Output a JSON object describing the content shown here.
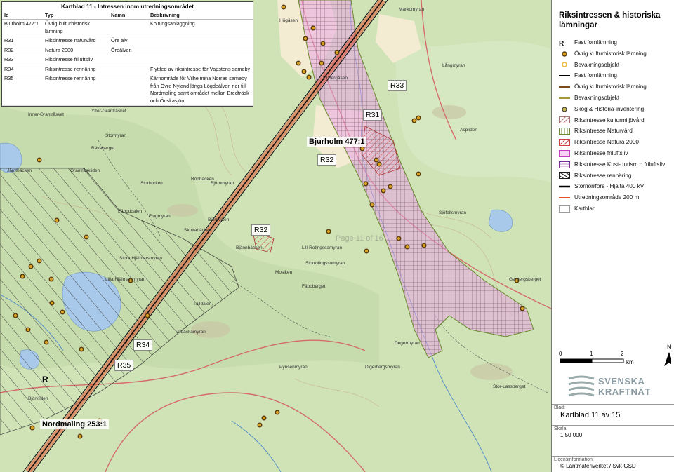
{
  "table": {
    "title": "Kartblad 11 - Intressen inom utredningsområdet",
    "headers": [
      "Id",
      "Typ",
      "Namn",
      "Beskrivning"
    ],
    "rows": [
      [
        "Bjurholm 477:1",
        "Övrig kulturhistorisk lämning",
        "",
        "Kolningsanläggning"
      ],
      [
        "R31",
        "Riksintresse naturvård",
        "Öre älv",
        ""
      ],
      [
        "R32",
        "Natura 2000",
        "Öreälven",
        ""
      ],
      [
        "R33",
        "Riksintresse friluftsliv",
        "",
        ""
      ],
      [
        "R34",
        "Riksintresse rennäring",
        "",
        "Flyttled av riksintresse för Vapstens sameby"
      ],
      [
        "R35",
        "Riksintresse rennäring",
        "",
        "Kärnområde för Vilhelmina Norras sameby från Övre Nyland längs Lögdeälven ner till Nordmaling samt området mellan Bredträsk och Önskasjön"
      ]
    ]
  },
  "map_labels": {
    "r33": "R33",
    "r31": "R31",
    "bjurholm": "Bjurholm 477:1",
    "r32a": "R32",
    "r32b": "R32",
    "r34": "R34",
    "r35": "R35",
    "nordmaling": "Nordmaling 253:1",
    "r_single": "R",
    "page_watermark": "Page 11 of 16"
  },
  "place_names": [
    "Högåsen",
    "Markomyran",
    "Lillbergåsen",
    "Ytter-Grantråsket",
    "Inner-Grantråsket",
    "Rävaberget",
    "Grantråskliden",
    "Stormyran",
    "Fäboddalen",
    "Flugmyran",
    "Skottabäcken",
    "Björnmyran",
    "Bjännbäcken",
    "Lill-Rotingssamyran",
    "Storrotingssamyran",
    "Mosiken",
    "Fäboberget",
    "Aspliden",
    "Långmyran",
    "Degermyran",
    "Stor-Lassberget",
    "Björkliden",
    "Tälldalen",
    "Jämtbäcken",
    "Stora Hjälmarsmyran",
    "Lilla Hjälmarsmyran",
    "Vitbäckamyran",
    "Gerbergsberget",
    "Sjöfallsmyran",
    "Digerbergsmyran",
    "Storborken",
    "Björnviken",
    "Pynsenmyran",
    "Rödbäcken"
  ],
  "legend": {
    "title": "Riksintressen & historiska lämningar",
    "items": [
      {
        "label": "Fast fornlämning",
        "sym": "letter-r"
      },
      {
        "label": "Övrig kulturhistorisk lämning",
        "sym": "dot-brown"
      },
      {
        "label": "Bevakningsobjekt",
        "sym": "dot-yellow"
      },
      {
        "label": "Fast fornlämning",
        "sym": "line-black"
      },
      {
        "label": "Övrig kulturhistorisk lämning",
        "sym": "line-brown"
      },
      {
        "label": "Bevakningsobjekt",
        "sym": "line-olive"
      },
      {
        "label": "Skog & Historia-inventering",
        "sym": "dot-olive"
      },
      {
        "label": "Riksintresse kulturmiljövård",
        "sym": "hatch-brown"
      },
      {
        "label": "Riksintresse Naturvård",
        "sym": "vert-green"
      },
      {
        "label": "Riksintresse Natura 2000",
        "sym": "hatch-red"
      },
      {
        "label": "Riksintresse friluftsliv",
        "sym": "box-magenta"
      },
      {
        "label": "Riksintresse Kust- turism o friluftsliv",
        "sym": "box-purple"
      },
      {
        "label": "Riksintresse rennäring",
        "sym": "hatch-black"
      },
      {
        "label": "Stornorrfors - Hjälta 400 kV",
        "sym": "line-power"
      },
      {
        "label": "Utredningsområde 200 m",
        "sym": "line-red"
      },
      {
        "label": "Kartblad",
        "sym": "box-grey"
      }
    ]
  },
  "scale": {
    "ticks": [
      "0",
      "1",
      "2"
    ],
    "unit": "km",
    "north": "N"
  },
  "logo": {
    "line1": "SVENSKA",
    "line2": "KRAFTNÄT"
  },
  "info": {
    "blad_label": "Blad:",
    "blad_value": "Kartblad 11 av 15",
    "skala_label": "Skala:",
    "skala_value": "1:50 000",
    "licens_label": "Licensinformation:",
    "licens_value": "© Lantmäteriverket / Svk-GSD"
  },
  "colors": {
    "map_bg": "#cfe3b7",
    "natura_hatch": "#9b7a8a",
    "friluftsliv": "#e9a6e6",
    "naturvard": "#6a8a2e",
    "rennaring_hatch": "#2b2b2b",
    "water": "#a8c9ea",
    "powerline": "#e2502d",
    "roads": "#d46c6c"
  }
}
